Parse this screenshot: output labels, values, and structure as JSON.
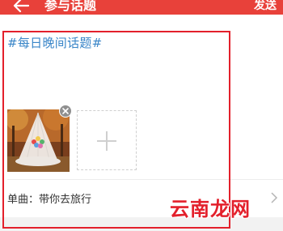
{
  "header": {
    "title": "参与话题",
    "send_label": "发送",
    "back_icon": "arrow-left-icon",
    "background_color": "#e8413a"
  },
  "post": {
    "hashtag": "#每日晚间话题#",
    "hashtag_color": "#3a86c8"
  },
  "attachments": {
    "photo_icon": "photo-thumbnail",
    "remove_icon": "close-icon",
    "add_icon": "plus-icon"
  },
  "song": {
    "label": "单曲：带你去旅行",
    "chevron_icon": "chevron-right-icon"
  },
  "overlay": {
    "watermark": "云南龙网",
    "highlight_color": "#e3202b"
  }
}
